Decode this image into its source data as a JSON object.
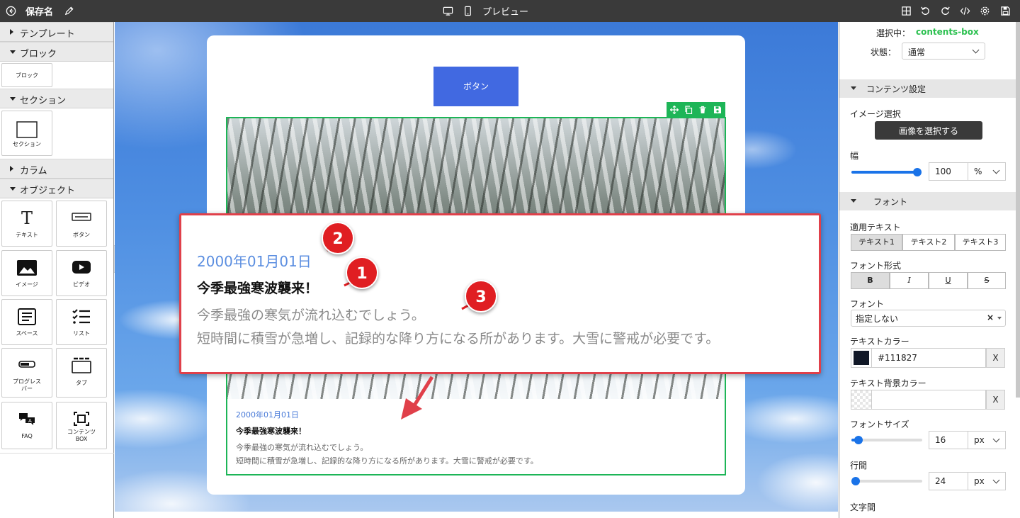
{
  "topbar": {
    "save_name": "保存名",
    "preview_label": "プレビュー",
    "icons": [
      "back-icon",
      "edit-icon",
      "desktop-icon",
      "mobile-icon",
      "grid-icon",
      "undo-icon",
      "redo-icon",
      "code-icon",
      "gear-icon",
      "save-icon"
    ]
  },
  "left_panel": {
    "sections": {
      "template": "テンプレート",
      "block": "ブロック",
      "section": "セクション",
      "column": "カラム",
      "object": "オブジェクト"
    },
    "block_tile": "ブロック",
    "section_tile": "セクション",
    "objects": [
      "テキスト",
      "ボタン",
      "イメージ",
      "ビデオ",
      "スペース",
      "リスト",
      "プログレス",
      "バー",
      "タブ",
      "FAQ",
      "コンテンツ",
      "BOX"
    ]
  },
  "canvas": {
    "button_label": "ボタン",
    "box": {
      "date": "2000年01月01日",
      "title": "今季最強寒波襲来！",
      "body_line1": "今季最強の寒気が流れ込むでしょう。",
      "body_line2": "短時間に積雪が急増し、記録的な降り方になる所があります。大雪に警戒が必要です。"
    },
    "accent": "#1db557"
  },
  "callout": {
    "date": "2000年01月01日",
    "title": "今季最強寒波襲来！",
    "body_line1": "今季最強の寒気が流れ込むでしょう。",
    "body_line2": "短時間に積雪が急増し、記録的な降り方になる所があります。大雪に警戒が必要です。",
    "badges": [
      "1",
      "2",
      "3"
    ],
    "color": "#e0404a"
  },
  "right_panel": {
    "selected_label": "選択中：",
    "selected_value": "contents-box",
    "state_label": "状態：",
    "state_value": "通常",
    "content_settings": "コンテンツ設定",
    "image_select_label": "イメージ選択",
    "image_select_button": "画像を選択する",
    "width_label": "幅",
    "width_value": "100",
    "width_unit": "%",
    "width_fraction": 1.0,
    "font_section": "フォント",
    "apply_text_label": "適用テキスト",
    "text_tabs": [
      "テキスト1",
      "テキスト2",
      "テキスト3"
    ],
    "font_style_label": "フォント形式",
    "font_style_buttons": [
      "B",
      "I",
      "U",
      "S"
    ],
    "font_label": "フォント",
    "font_value": "指定しない",
    "text_color_label": "テキストカラー",
    "text_color_value": "#111827",
    "text_bg_color_label": "テキスト背景カラー",
    "clear_label": "X",
    "font_size_label": "フォントサイズ",
    "font_size_value": "16",
    "font_size_unit": "px",
    "line_height_label": "行間",
    "line_height_value": "24",
    "line_height_unit": "px",
    "letter_spacing_label": "文字間"
  }
}
